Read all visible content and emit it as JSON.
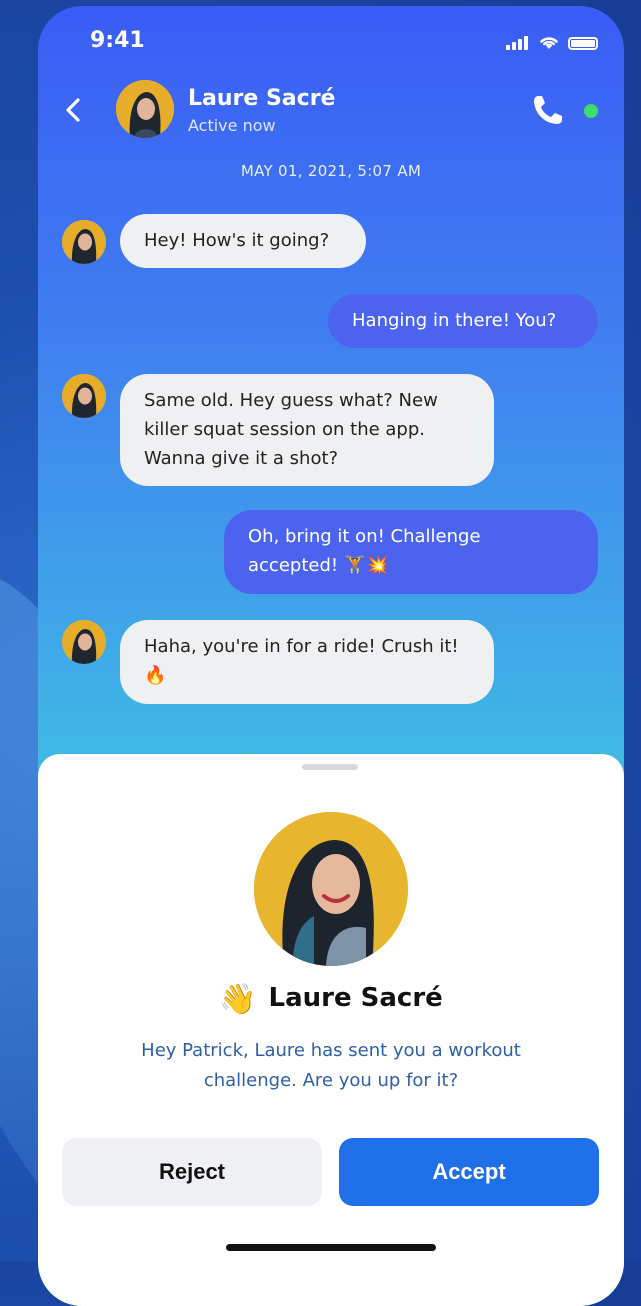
{
  "status_bar": {
    "time": "9:41"
  },
  "header": {
    "name": "Laure Sacré",
    "status": "Active now"
  },
  "chat": {
    "date_stamp": "MAY 01, 2021,  5:07 AM",
    "messages": [
      {
        "from": "them",
        "text": "Hey! How's it going?"
      },
      {
        "from": "me",
        "text": "Hanging in there! You?"
      },
      {
        "from": "them",
        "text": "Same old. Hey guess what? New killer squat session on the app. Wanna give it a shot?"
      },
      {
        "from": "me",
        "text": "Oh, bring it on! Challenge accepted! 🏋️💥"
      },
      {
        "from": "them",
        "text": "Haha, you're in for a ride! Crush it! 🔥"
      }
    ]
  },
  "sheet": {
    "wave_emoji": "👋",
    "name": "Laure Sacré",
    "message": "Hey Patrick, Laure has sent you a workout challenge. Are you up for it?",
    "reject_label": "Reject",
    "accept_label": "Accept"
  },
  "colors": {
    "accent": "#1e6fe8",
    "outgoing_bubble": "#4c63f0",
    "online": "#3ddc6b"
  }
}
